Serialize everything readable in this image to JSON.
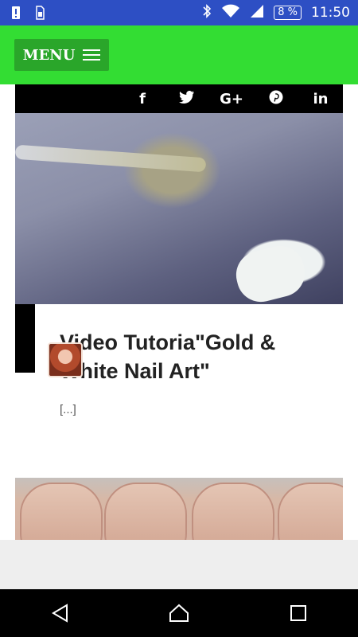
{
  "status_bar": {
    "battery": "8 %",
    "time": "11:50",
    "icons": [
      "alert-icon",
      "sim-card-icon",
      "bluetooth-icon",
      "wifi-icon",
      "signal-icon",
      "battery-icon"
    ],
    "color": "#2d4fc4"
  },
  "app_bar": {
    "menu_label": "MENU",
    "color": "#33dd33"
  },
  "share": {
    "facebook": "f",
    "twitter": "twitter-icon",
    "google_plus": "G+",
    "pinterest": "pinterest-icon",
    "linkedin": "in"
  },
  "post": {
    "title": "Video Tutoria\"Gold & White Nail Art\"",
    "excerpt": "[...]"
  },
  "nav_bar": {
    "icons": [
      "back-icon",
      "home-icon",
      "recents-icon"
    ]
  }
}
